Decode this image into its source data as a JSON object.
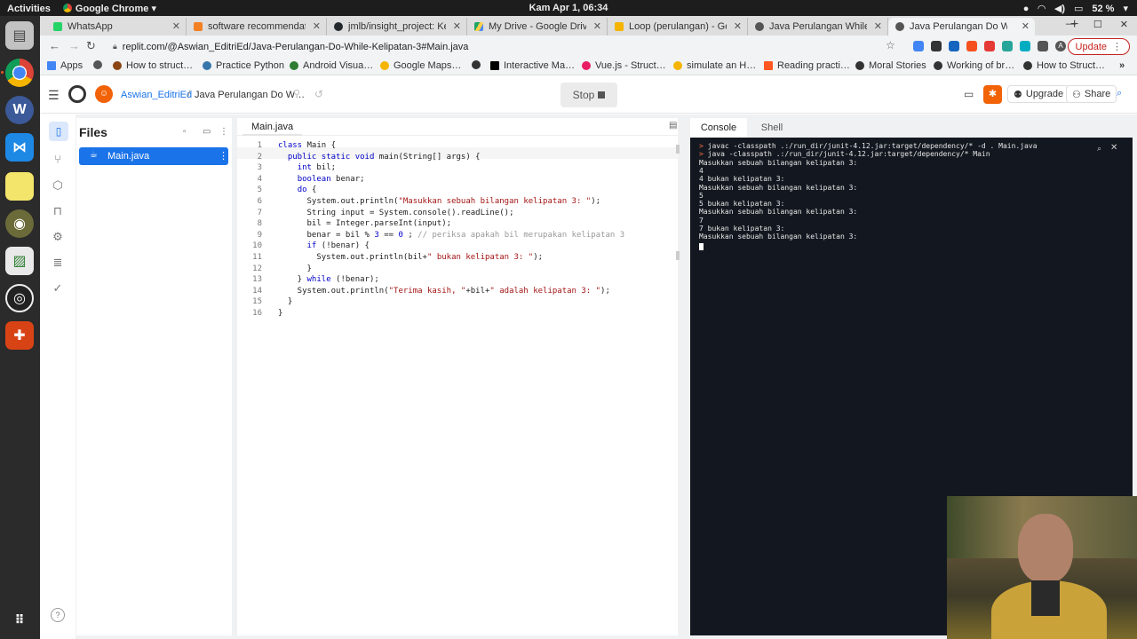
{
  "topbar": {
    "activities": "Activities",
    "app": "Google Chrome",
    "clock": "Kam Apr  1, 06:34",
    "battery": "52 %"
  },
  "tabs": [
    {
      "title": "WhatsApp",
      "color": "#25d366"
    },
    {
      "title": "software recommendatio",
      "color": "#f48024"
    },
    {
      "title": "jmlb/insight_project: Ke",
      "color": "#24292e"
    },
    {
      "title": "My Drive - Google Drive",
      "color": "#1fa463"
    },
    {
      "title": "Loop (perulangan) - Goo",
      "color": "#f4b400"
    },
    {
      "title": "Java Perulangan While In",
      "color": "#555555"
    },
    {
      "title": "Java Perulangan Do Whi",
      "color": "#555555"
    }
  ],
  "toolbar": {
    "url": "replit.com/@Aswian_EditriEd/Java-Perulangan-Do-While-Kelipatan-3#Main.java",
    "update_label": "Update",
    "profile_letter": "A"
  },
  "bookmarks": [
    {
      "label": "Apps",
      "color": "#4285f4"
    },
    {
      "label": "",
      "color": "#555555"
    },
    {
      "label": "How to struct…",
      "color": "#8b4513"
    },
    {
      "label": "Practice Python",
      "color": "#3776ab"
    },
    {
      "label": "Android Visua…",
      "color": "#2e7d32"
    },
    {
      "label": "Google Maps…",
      "color": "#f4b400"
    },
    {
      "label": "",
      "color": "#333333"
    },
    {
      "label": "Interactive Ma…",
      "color": "#000000"
    },
    {
      "label": "Vue.js - Struct…",
      "color": "#e91e63"
    },
    {
      "label": "simulate an H…",
      "color": "#f4b400"
    },
    {
      "label": "Reading practi…",
      "color": "#ff5722"
    },
    {
      "label": "Moral Stories",
      "color": "#333333"
    },
    {
      "label": "Working of br…",
      "color": "#333333"
    },
    {
      "label": "How to Struct…",
      "color": "#333333"
    }
  ],
  "replit": {
    "user": "Aswian_EditriEd",
    "sep": "/",
    "repl": "Java Perulangan Do W…",
    "stop_label": "Stop",
    "upgrade_label": "Upgrade",
    "share_label": "Share",
    "files_title": "Files",
    "file_name": "Main.java",
    "editor_tab": "Main.java",
    "console_tab": "Console",
    "shell_tab": "Shell",
    "help": "?"
  },
  "code": [
    {
      "n": "1",
      "html": "<span class=\"kw\">class</span> Main {"
    },
    {
      "n": "2",
      "html": "  <span class=\"kw\">public static void</span> main(String[] args) {"
    },
    {
      "n": "3",
      "html": "    <span class=\"kw\">int</span> bil;"
    },
    {
      "n": "4",
      "html": "    <span class=\"kw\">boolean</span> benar;"
    },
    {
      "n": "5",
      "html": "    <span class=\"kw\">do</span> {"
    },
    {
      "n": "6",
      "html": "      System.out.println(<span class=\"st\">\"Masukkan sebuah bilangan kelipatan 3: \"</span>);"
    },
    {
      "n": "7",
      "html": "      String input = System.console().readLine();"
    },
    {
      "n": "8",
      "html": "      bil = Integer.parseInt(input);"
    },
    {
      "n": "9",
      "html": "      benar = bil % <span class=\"kw\">3</span> == <span class=\"kw\">0</span> ; <span class=\"cm\">// periksa apakah bil merupakan kelipatan 3</span>"
    },
    {
      "n": "10",
      "html": "      <span class=\"kw\">if</span> (!benar) {"
    },
    {
      "n": "11",
      "html": "        System.out.println(bil+<span class=\"st\">\" bukan kelipatan 3: \"</span>);"
    },
    {
      "n": "12",
      "html": "      }"
    },
    {
      "n": "13",
      "html": "    } <span class=\"kw\">while</span> (!benar);"
    },
    {
      "n": "14",
      "html": "    System.out.println(<span class=\"st\">\"Terima kasih, \"</span>+bil+<span class=\"st\">\" adalah kelipatan 3: \"</span>);"
    },
    {
      "n": "15",
      "html": "  }"
    },
    {
      "n": "16",
      "html": "}"
    }
  ],
  "console": [
    {
      "prompt": ">",
      "text": " javac -classpath .:/run_dir/junit-4.12.jar:target/dependency/* -d . Main.java"
    },
    {
      "prompt": ">",
      "text": " java -classpath .:/run_dir/junit-4.12.jar:target/dependency/* Main"
    },
    {
      "prompt": "",
      "text": "Masukkan sebuah bilangan kelipatan 3:"
    },
    {
      "prompt": "",
      "text": "4"
    },
    {
      "prompt": "",
      "text": "4 bukan kelipatan 3:"
    },
    {
      "prompt": "",
      "text": "Masukkan sebuah bilangan kelipatan 3:"
    },
    {
      "prompt": "",
      "text": "5"
    },
    {
      "prompt": "",
      "text": "5 bukan kelipatan 3:"
    },
    {
      "prompt": "",
      "text": "Masukkan sebuah bilangan kelipatan 3:"
    },
    {
      "prompt": "",
      "text": "7"
    },
    {
      "prompt": "",
      "text": "7 bukan kelipatan 3:"
    },
    {
      "prompt": "",
      "text": "Masukkan sebuah bilangan kelipatan 3:"
    }
  ],
  "colors": {
    "replit_orange": "#f26207",
    "selected_file": "#1a73e8",
    "terminal_bg": "#131820"
  }
}
